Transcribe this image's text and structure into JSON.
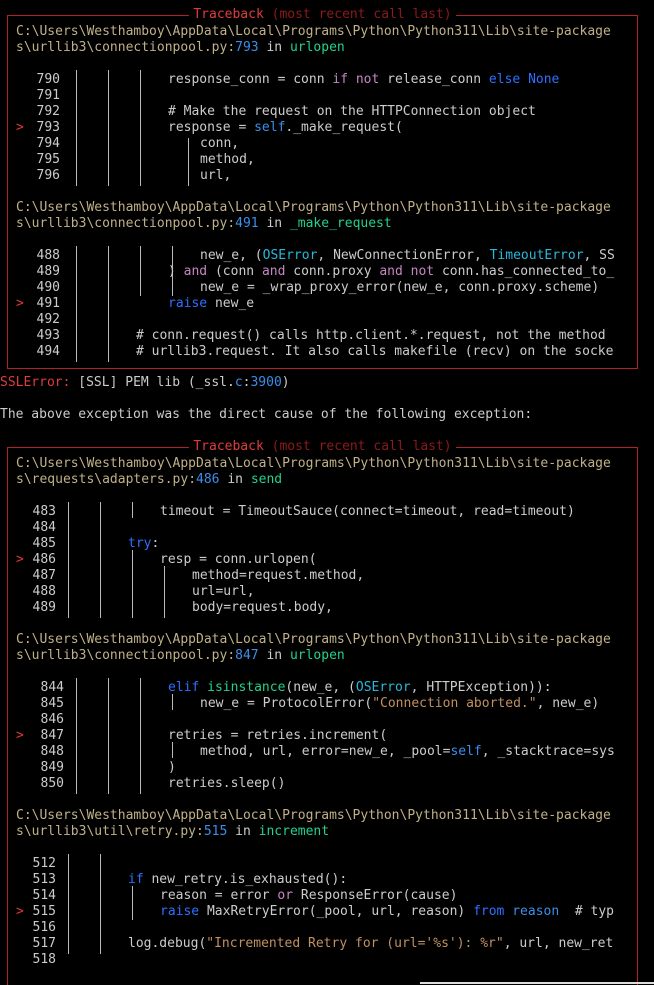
{
  "traceback_title": "Traceback",
  "traceback_subtitle": "(most recent call last)",
  "frames1": [
    {
      "path1": "C:\\Users\\Westhamboy\\AppData\\Local\\Programs\\Python\\Python311\\Lib\\site-package",
      "path2": "s\\urllib3\\connectionpool.py",
      "line": "793",
      "in": "in",
      "func": "urlopen"
    },
    {
      "path1": "C:\\Users\\Westhamboy\\AppData\\Local\\Programs\\Python\\Python311\\Lib\\site-package",
      "path2": "s\\urllib3\\connectionpool.py",
      "line": "491",
      "in": "in",
      "func": "_make_request"
    }
  ],
  "frames2": [
    {
      "path1": "C:\\Users\\Westhamboy\\AppData\\Local\\Programs\\Python\\Python311\\Lib\\site-package",
      "path2": "s\\requests\\adapters.py",
      "line": "486",
      "in": "in",
      "func": "send"
    },
    {
      "path1": "C:\\Users\\Westhamboy\\AppData\\Local\\Programs\\Python\\Python311\\Lib\\site-package",
      "path2": "s\\urllib3\\connectionpool.py",
      "line": "847",
      "in": "in",
      "func": "urlopen"
    },
    {
      "path1": "C:\\Users\\Westhamboy\\AppData\\Local\\Programs\\Python\\Python311\\Lib\\site-package",
      "path2": "s\\urllib3\\util\\retry.py",
      "line": "515",
      "in": "in",
      "func": "increment"
    }
  ],
  "line_numbers": {
    "f1": [
      "790",
      "791",
      "792",
      "793",
      "794",
      "795",
      "796"
    ],
    "f2": [
      "488",
      "489",
      "490",
      "491",
      "492",
      "493",
      "494"
    ],
    "f3": [
      "483",
      "484",
      "485",
      "486",
      "487",
      "488",
      "489"
    ],
    "f4": [
      "844",
      "845",
      "846",
      "847",
      "848",
      "849",
      "850"
    ],
    "f5": [
      "512",
      "513",
      "514",
      "515",
      "516",
      "517",
      "518"
    ]
  },
  "marker": ">",
  "ssl_error": {
    "label": "SSLError:",
    "msg": " [SSL] PEM lib (_ssl.",
    "c": "c",
    "colon": ":",
    "num": "3900",
    "close": ")"
  },
  "cause_text": "The above exception was the direct cause of the following exception:",
  "colors": {
    "border": "#b22222",
    "path": "#c0b088",
    "number": "#3b8eea",
    "function": "#23d18b",
    "keyword": "#c586c0",
    "string": "#c09060"
  }
}
